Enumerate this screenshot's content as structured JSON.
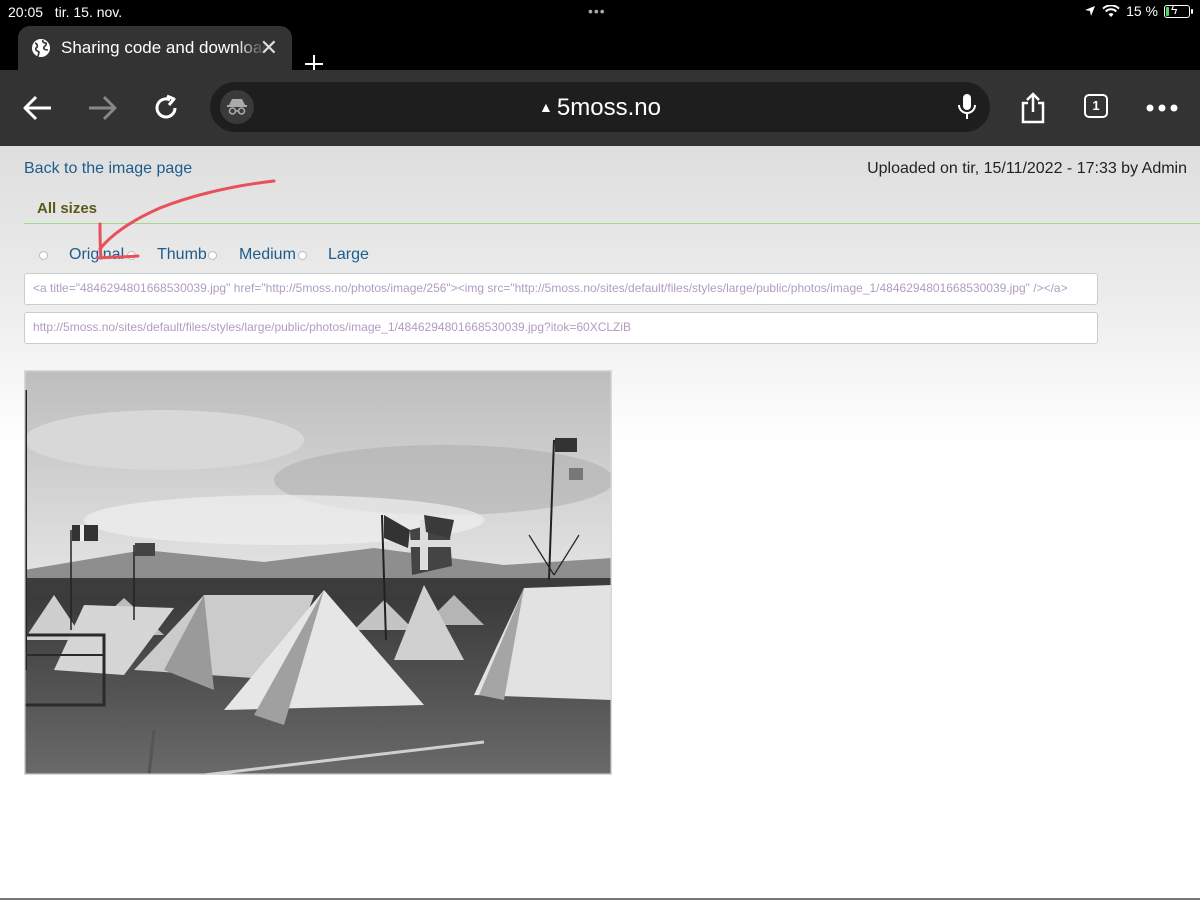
{
  "status_bar": {
    "time": "20:05",
    "date": "tir. 15. nov.",
    "battery_percent": "15 %",
    "battery_level": 0.15
  },
  "tab": {
    "title": "Sharing code and download"
  },
  "toolbar": {
    "url": "5moss.no",
    "tab_count": "1"
  },
  "page": {
    "back_link": "Back to the image page",
    "uploaded_info": "Uploaded on tir, 15/11/2022 - 17:33 by Admin",
    "section_title": "All sizes",
    "sizes": [
      "Original",
      "Thumb",
      "Medium",
      "Large"
    ],
    "html_code": "<a title=\"4846294801668530039.jpg\" href=\"http://5moss.no/photos/image/256\"><img src=\"http://5moss.no/sites/default/files/styles/large/public/photos/image_1/4846294801668530039.jpg\" /></a>",
    "image_url": "http://5moss.no/sites/default/files/styles/large/public/photos/image_1/4846294801668530039.jpg?itok=60XCLZiB"
  },
  "colors": {
    "link": "#1e5c8c",
    "section_title": "#5c5a1a",
    "annotation": "#e8505b",
    "toolbar_bg": "#333333"
  },
  "icons": [
    "globe-icon",
    "close-icon",
    "plus-icon",
    "back-arrow-icon",
    "forward-arrow-icon",
    "reload-icon",
    "incognito-icon",
    "microphone-icon",
    "share-icon",
    "tabs-icon",
    "more-icon",
    "location-icon",
    "wifi-icon",
    "battery-icon"
  ]
}
